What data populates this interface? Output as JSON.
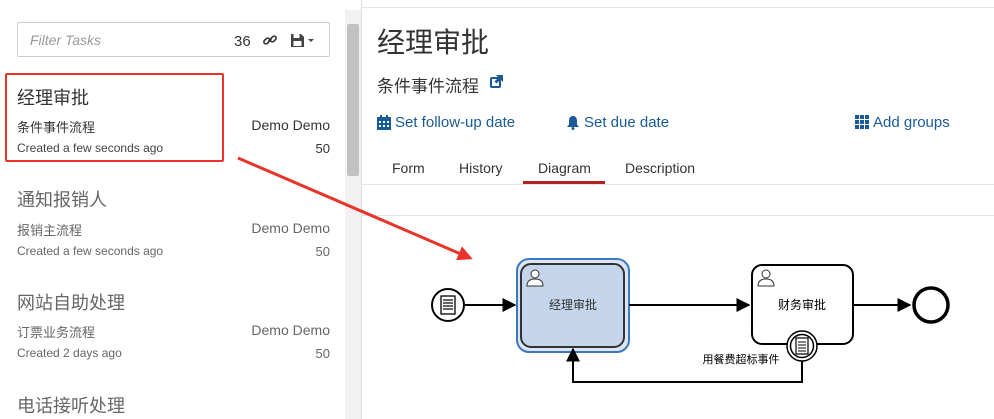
{
  "filter": {
    "placeholder": "Filter Tasks",
    "count": "36",
    "link_icon": "link-icon",
    "save_icon": "save-dropdown-icon"
  },
  "tasks": [
    {
      "name": "经理审批",
      "process": "条件事件流程",
      "assignee": "Demo Demo",
      "created": "Created a few seconds ago",
      "priority": "50"
    },
    {
      "name": "通知报销人",
      "process": "报销主流程",
      "assignee": "Demo Demo",
      "created": "Created a few seconds ago",
      "priority": "50"
    },
    {
      "name": "网站自助处理",
      "process": "订票业务流程",
      "assignee": "Demo Demo",
      "created": "Created 2 days ago",
      "priority": "50"
    },
    {
      "name": "电话接听处理"
    }
  ],
  "detail": {
    "title": "经理审批",
    "process": "条件事件流程",
    "actions": {
      "follow_up": "Set follow-up date",
      "due": "Set due date",
      "groups": "Add groups"
    },
    "tabs": [
      "Form",
      "History",
      "Diagram",
      "Description"
    ],
    "active_tab": "Diagram"
  },
  "diagram": {
    "task1": "经理审批",
    "task2": "财务审批",
    "boundary_event": "用餐费超标事件"
  },
  "colors": {
    "link": "#1a5a96",
    "highlight": "#e8342a",
    "active_task_fill": "#c5d5ec",
    "active_task_border": "#3c7ac0",
    "tab_underline": "#b22222"
  }
}
